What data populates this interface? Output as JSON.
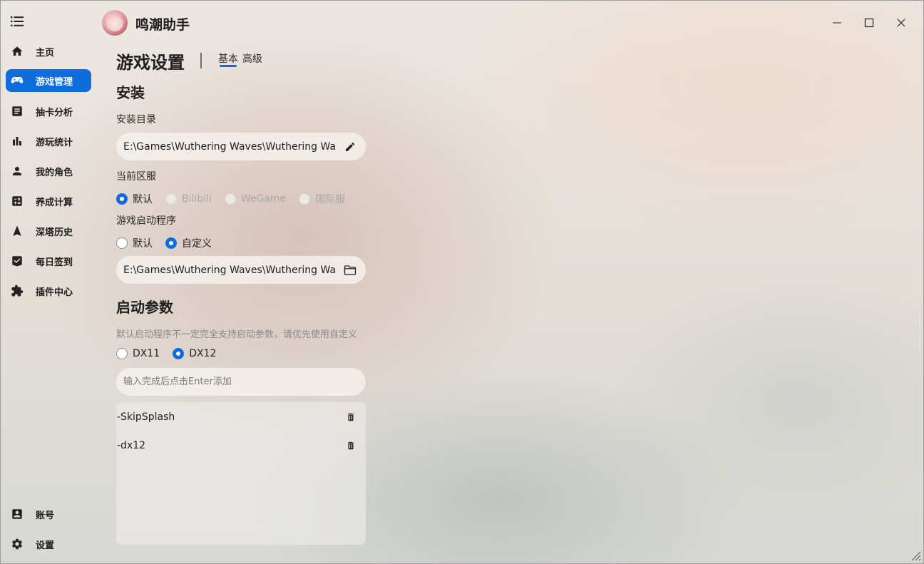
{
  "app": {
    "title": "鸣潮助手"
  },
  "sidebar": {
    "items": [
      {
        "label": "主页",
        "icon": "home-icon"
      },
      {
        "label": "游戏管理",
        "icon": "gamepad-icon",
        "active": true
      },
      {
        "label": "抽卡分析",
        "icon": "document-icon"
      },
      {
        "label": "游玩统计",
        "icon": "bar-chart-icon"
      },
      {
        "label": "我的角色",
        "icon": "person-icon"
      },
      {
        "label": "养成计算",
        "icon": "calculator-icon"
      },
      {
        "label": "深塔历史",
        "icon": "navigation-arrow-icon"
      },
      {
        "label": "每日签到",
        "icon": "check-badge-icon"
      },
      {
        "label": "插件中心",
        "icon": "puzzle-icon"
      }
    ],
    "bottom_items": [
      {
        "label": "账号",
        "icon": "account-box-icon"
      },
      {
        "label": "设置",
        "icon": "gear-icon"
      }
    ]
  },
  "header": {
    "page_title": "游戏设置",
    "tabs": [
      {
        "label": "基本",
        "active": true
      },
      {
        "label": "高级",
        "active": false
      }
    ]
  },
  "install": {
    "section_title": "安装",
    "dir_label": "安装目录",
    "dir_value": "E:\\Games\\Wuthering Waves\\Wuthering Waves Game",
    "server_label": "当前区服",
    "servers": [
      {
        "label": "默认",
        "checked": true,
        "disabled": false
      },
      {
        "label": "Bilibili",
        "checked": false,
        "disabled": true
      },
      {
        "label": "WeGame",
        "checked": false,
        "disabled": true
      },
      {
        "label": "国际服",
        "checked": false,
        "disabled": true
      }
    ],
    "launcher_label": "游戏启动程序",
    "launcher_options": [
      {
        "label": "默认",
        "checked": false
      },
      {
        "label": "自定义",
        "checked": true
      }
    ],
    "launcher_value": "E:\\Games\\Wuthering Waves\\Wuthering Waves Game"
  },
  "launch_params": {
    "section_title": "启动参数",
    "hint": "默认启动程序不一定完全支持启动参数，请优先使用自定义",
    "dx_options": [
      {
        "label": "DX11",
        "checked": false
      },
      {
        "label": "DX12",
        "checked": true
      }
    ],
    "input_placeholder": "输入完成后点击Enter添加",
    "params": [
      "-SkipSplash",
      "-dx12"
    ]
  },
  "colors": {
    "accent": "#0f6cdc"
  }
}
